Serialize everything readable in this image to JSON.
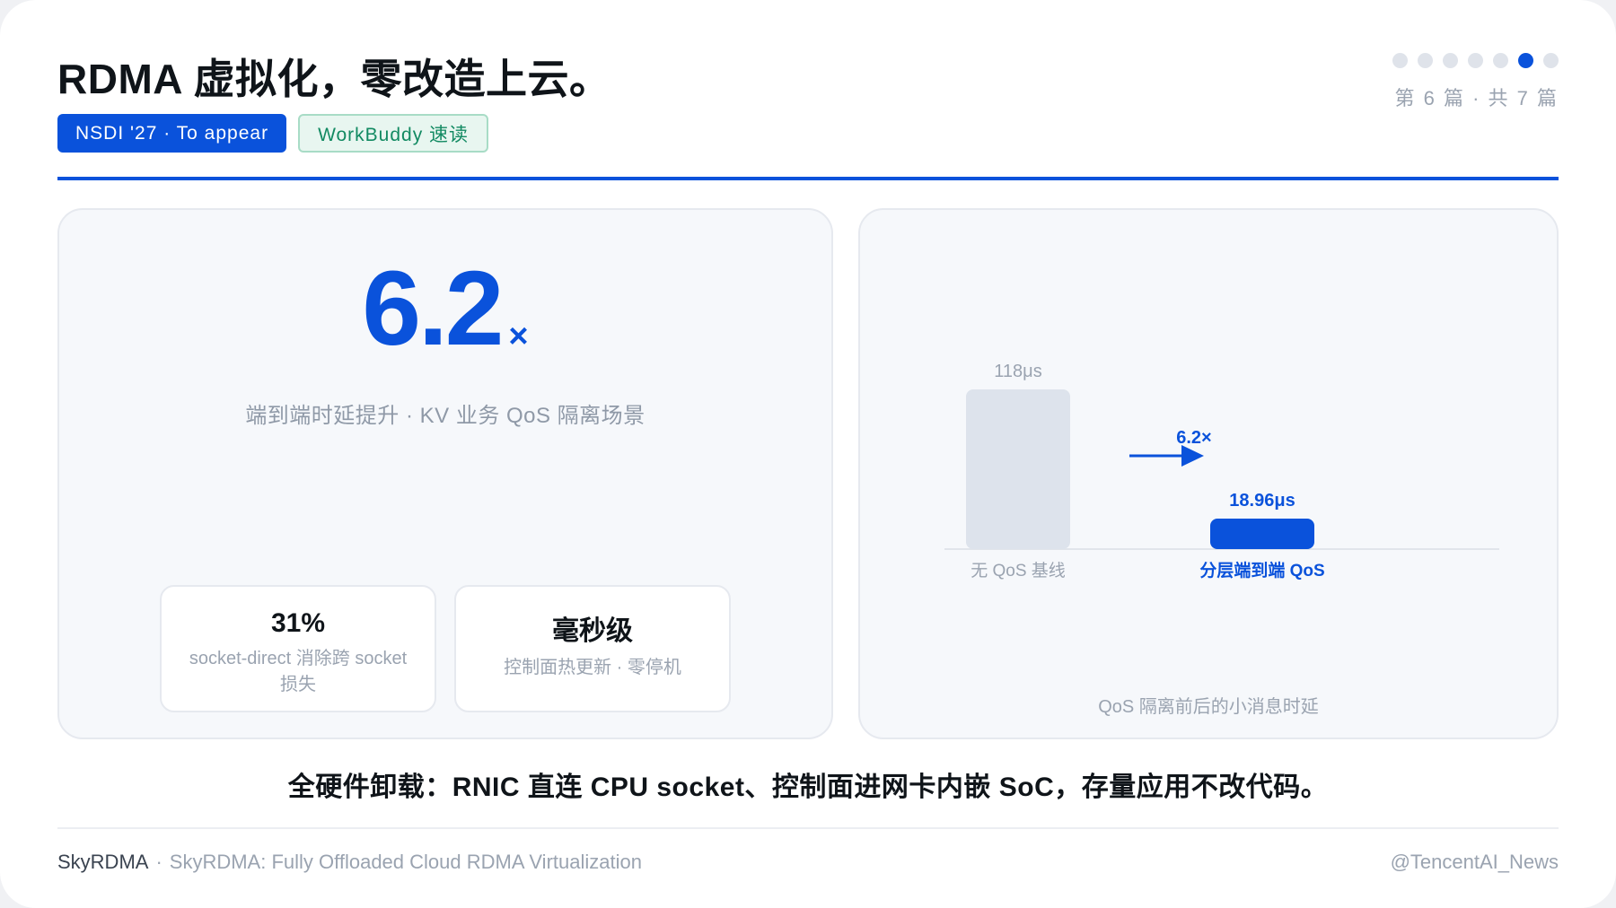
{
  "header": {
    "title": "RDMA 虚拟化，零改造上云。",
    "tags": [
      "NSDI '27 · To appear",
      "WorkBuddy 速读"
    ],
    "page_indicator": {
      "current": 6,
      "total": 7,
      "label": "第 6 篇 · 共 7 篇"
    }
  },
  "hero": {
    "value": "6.2",
    "suffix": "×",
    "caption": "端到端时延提升 · KV 业务 QoS 隔离场景"
  },
  "stats": [
    {
      "value": "31%",
      "label": "socket-direct 消除跨 socket 损失"
    },
    {
      "value": "毫秒级",
      "label": "控制面热更新 · 零停机"
    }
  ],
  "chart_data": {
    "type": "bar",
    "categories": [
      "无 QoS 基线",
      "分层端到端 QoS"
    ],
    "values": [
      118,
      18.96
    ],
    "value_labels": [
      "118μs",
      "18.96μs"
    ],
    "unit": "μs",
    "colors": [
      "#dde3ec",
      "#0a52db"
    ],
    "annotation": "6.2×",
    "caption": "QoS 隔离前后的小消息时延",
    "grid": false,
    "ylim": [
      0,
      118
    ]
  },
  "summary": "全硬件卸载：RNIC 直连 CPU socket、控制面进网卡内嵌 SoC，存量应用不改代码。",
  "footer": {
    "brand": "SkyRDMA",
    "separator": "·",
    "paper_title": "SkyRDMA: Fully Offloaded Cloud RDMA Virtualization",
    "handle": "@TencentAI_News"
  },
  "colors": {
    "accent": "#0a52db",
    "muted": "#9aa3b0",
    "tag_green": "#128a62"
  }
}
